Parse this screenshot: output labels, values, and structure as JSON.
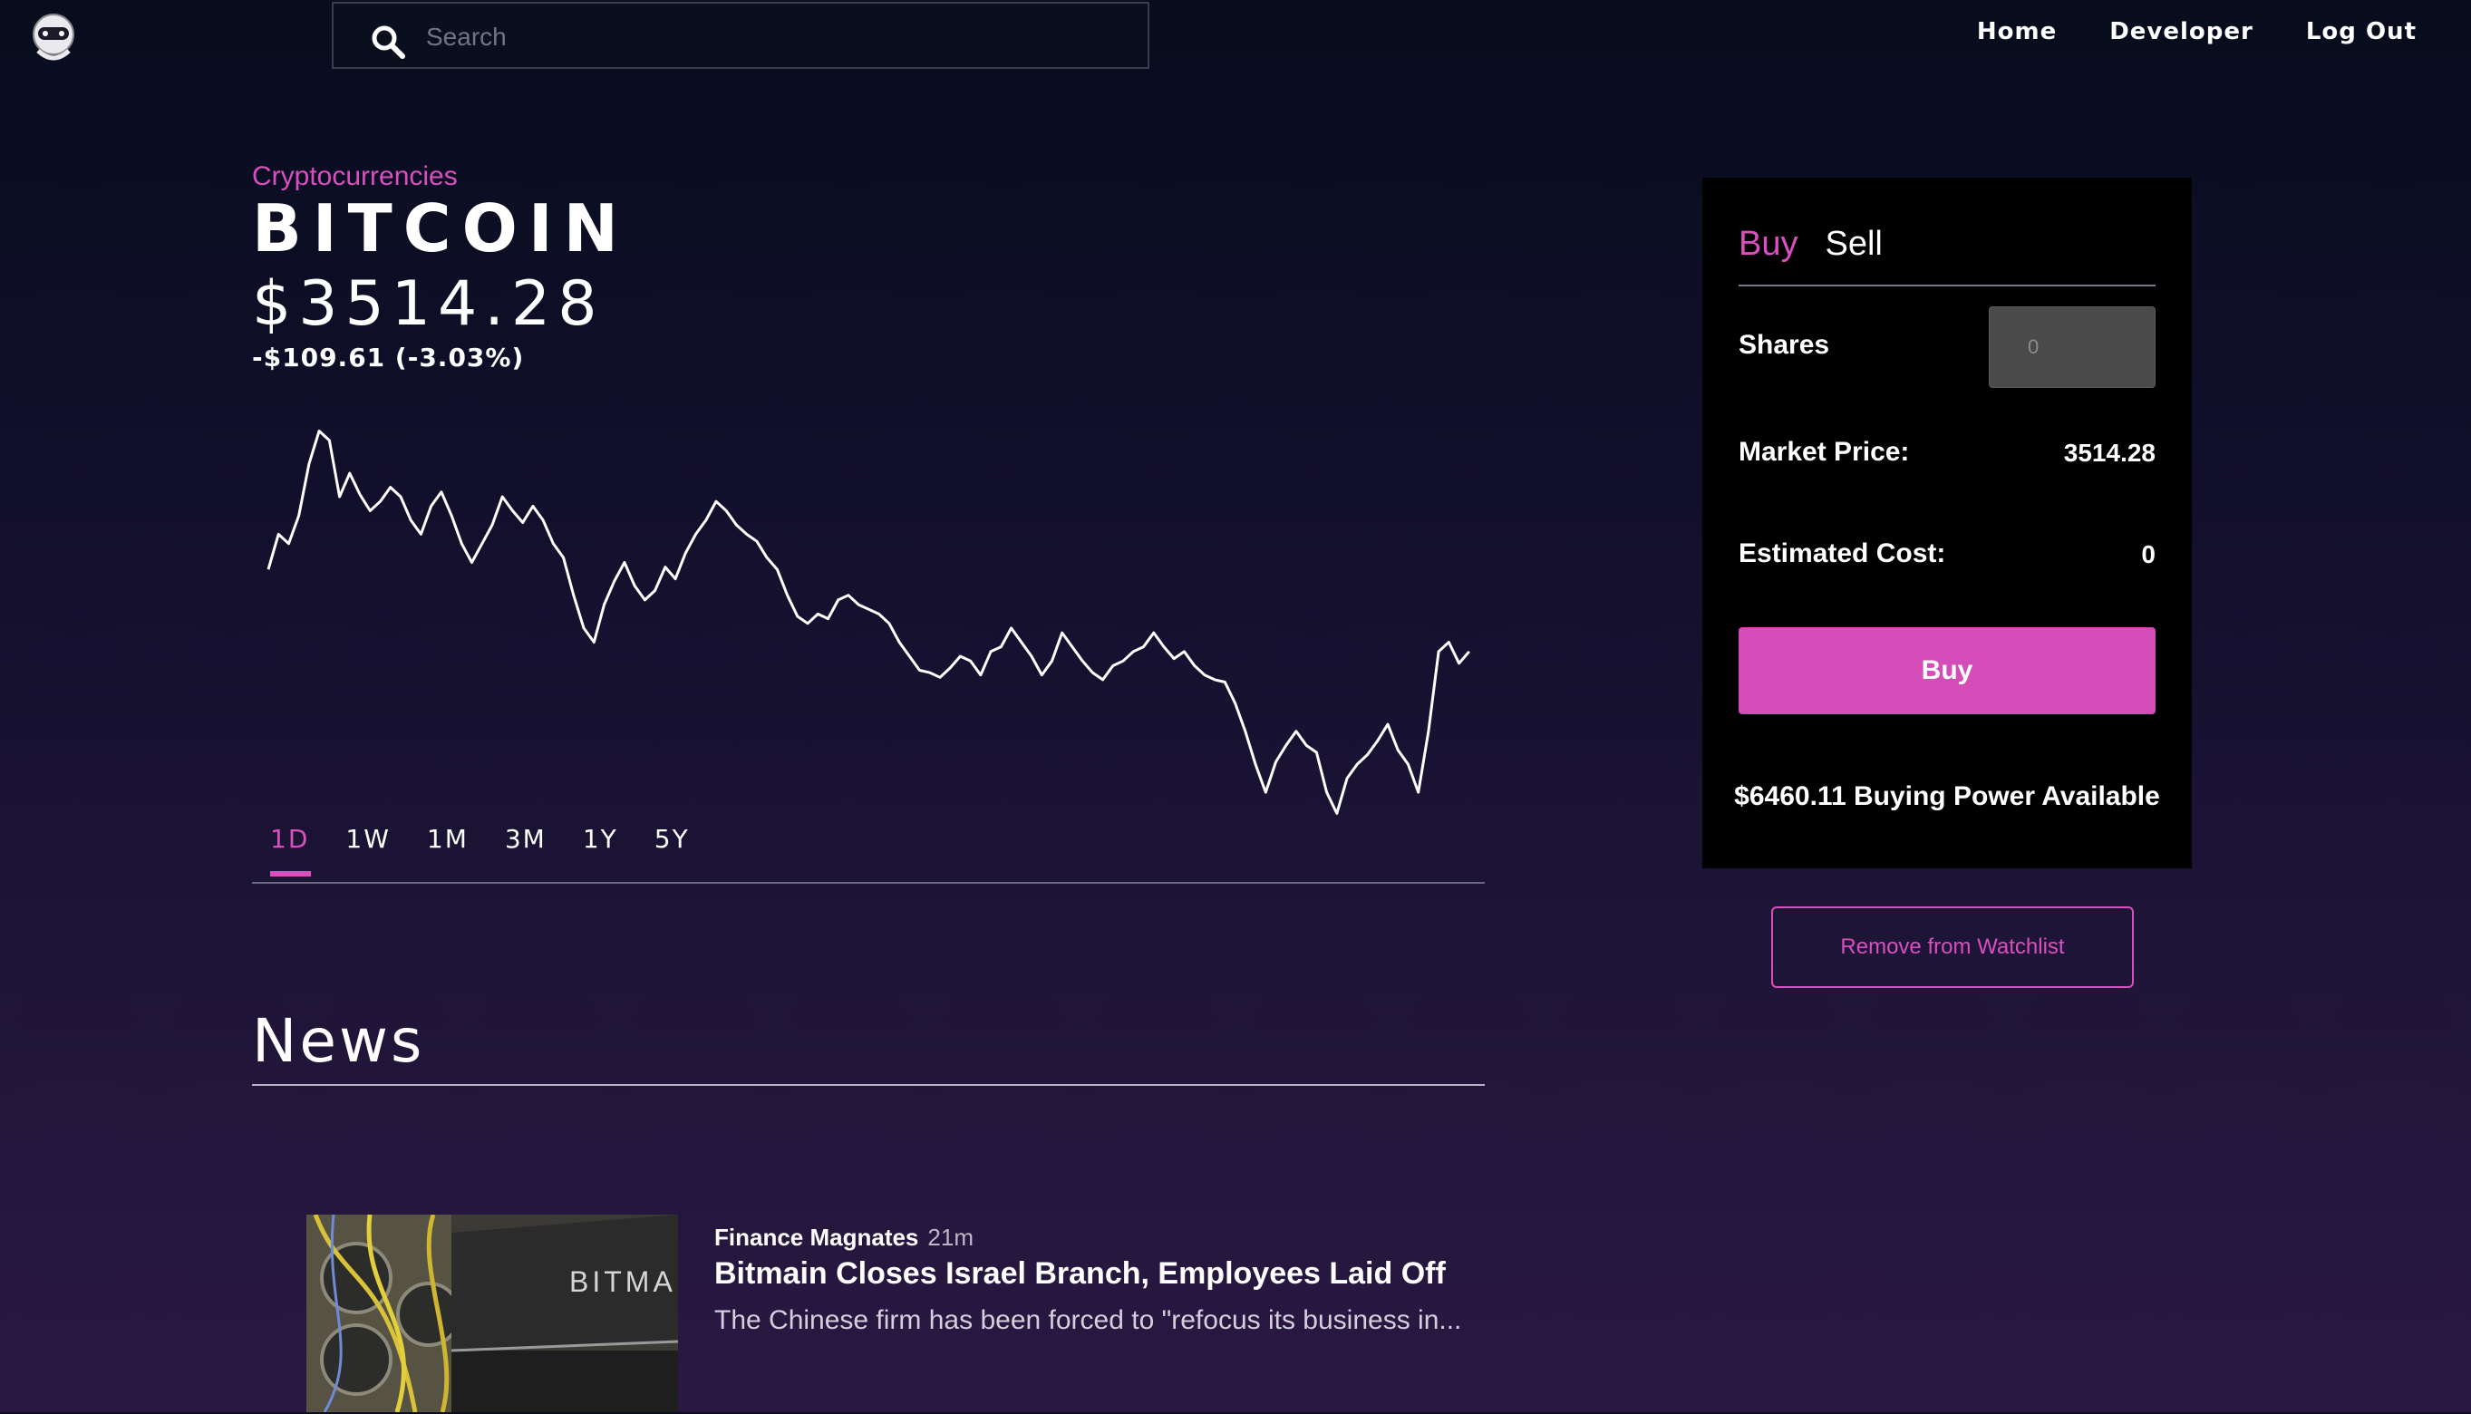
{
  "header": {
    "search": {
      "placeholder": "Search",
      "value": ""
    },
    "nav": [
      {
        "label": "Home"
      },
      {
        "label": "Developer"
      },
      {
        "label": "Log Out"
      }
    ]
  },
  "asset": {
    "category": "Cryptocurrencies",
    "name": "BITCOIN",
    "price": "$3514.28",
    "change": "-$109.61 (-3.03%)"
  },
  "chart_data": {
    "type": "line",
    "title": "",
    "xlabel": "",
    "ylabel": "",
    "grid": false,
    "values": [
      3545,
      3560,
      3556,
      3568,
      3590,
      3604,
      3600,
      3576,
      3586,
      3577,
      3570,
      3574,
      3580,
      3576,
      3566,
      3560,
      3572,
      3578,
      3568,
      3556,
      3548,
      3556,
      3564,
      3576,
      3570,
      3565,
      3572,
      3566,
      3556,
      3550,
      3534,
      3520,
      3514,
      3530,
      3540,
      3548,
      3538,
      3532,
      3536,
      3546,
      3541,
      3552,
      3560,
      3566,
      3574,
      3570,
      3564,
      3560,
      3557,
      3550,
      3545,
      3534,
      3525,
      3522,
      3526,
      3524,
      3532,
      3534,
      3530,
      3528,
      3526,
      3522,
      3514,
      3508,
      3502,
      3501,
      3499,
      3503,
      3508,
      3506,
      3500,
      3510,
      3512,
      3520,
      3514,
      3508,
      3500,
      3506,
      3518,
      3512,
      3506,
      3501,
      3498,
      3504,
      3506,
      3510,
      3512,
      3518,
      3512,
      3507,
      3510,
      3504,
      3500,
      3498,
      3497,
      3488,
      3476,
      3462,
      3450,
      3463,
      3470,
      3476,
      3470,
      3467,
      3450,
      3441,
      3456,
      3462,
      3466,
      3472,
      3479,
      3468,
      3462,
      3450,
      3476,
      3510,
      3514,
      3505,
      3510
    ],
    "ylim": [
      3440,
      3610
    ]
  },
  "ranges": [
    {
      "label": "1D",
      "active": true
    },
    {
      "label": "1W",
      "active": false
    },
    {
      "label": "1M",
      "active": false
    },
    {
      "label": "3M",
      "active": false
    },
    {
      "label": "1Y",
      "active": false
    },
    {
      "label": "5Y",
      "active": false
    }
  ],
  "news": {
    "title": "News",
    "items": [
      {
        "source": "Finance Magnates",
        "time": "21m",
        "headline": "Bitmain Closes Israel Branch, Employees Laid Off",
        "summary": "The Chinese firm has been forced to \"refocus its business in...",
        "image_text": "BITMA"
      }
    ]
  },
  "trade": {
    "tabs": [
      {
        "label": "Buy",
        "active": true
      },
      {
        "label": "Sell",
        "active": false
      }
    ],
    "shares_label": "Shares",
    "shares_placeholder": "0",
    "market_price_label": "Market Price:",
    "market_price_value": "3514.28",
    "estimated_cost_label": "Estimated Cost:",
    "estimated_cost_value": "0",
    "buy_button": "Buy",
    "buying_power": "$6460.11 Buying Power Available",
    "watchlist_button": "Remove from Watchlist"
  },
  "colors": {
    "accent": "#d94fbf",
    "panel": "#000000",
    "button": "#d44cb8"
  }
}
